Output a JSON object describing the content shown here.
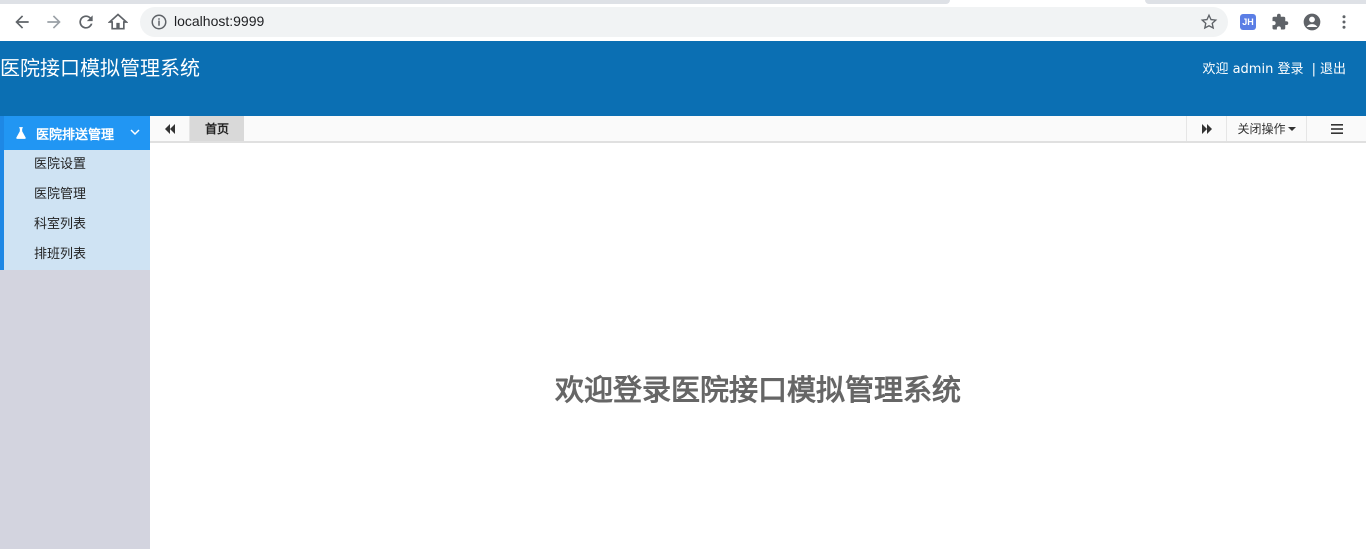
{
  "browser": {
    "url": "localhost:9999",
    "extension_badge": "JH"
  },
  "header": {
    "title": "医院接口模拟管理系统",
    "welcome": "欢迎 admin 登录",
    "separator": "|",
    "logout": "退出",
    "bg_color": "#0b6fb3"
  },
  "sidebar": {
    "group": {
      "label": "医院排送管理",
      "icon": "flask-icon",
      "expanded": true
    },
    "items": [
      {
        "label": "医院设置"
      },
      {
        "label": "医院管理"
      },
      {
        "label": "科室列表"
      },
      {
        "label": "排班列表"
      }
    ]
  },
  "tabs": {
    "items": [
      {
        "label": "首页",
        "active": true
      }
    ],
    "close_ops_label": "关闭操作"
  },
  "main": {
    "welcome_text": "欢迎登录医院接口模拟管理系统"
  }
}
